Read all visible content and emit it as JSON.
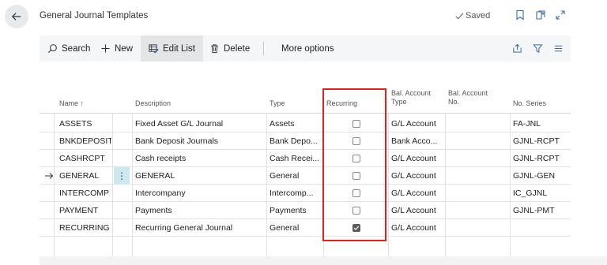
{
  "header": {
    "title": "General Journal Templates",
    "saved_label": "Saved"
  },
  "actions": {
    "search": "Search",
    "new": "New",
    "edit_list": "Edit List",
    "delete": "Delete",
    "more": "More options"
  },
  "columns": {
    "name": "Name ↑",
    "description": "Description",
    "type": "Type",
    "recurring": "Recurring",
    "bal_type_1": "Bal. Account",
    "bal_type_2": "Type",
    "bal_no_1": "Bal. Account",
    "bal_no_2": "No.",
    "no_series": "No. Series"
  },
  "rows": [
    {
      "name": "ASSETS",
      "description": "Fixed Asset G/L Journal",
      "type": "Assets",
      "recurring": false,
      "bal_type": "G/L Account",
      "bal_no": "",
      "no_series": "FA-JNL"
    },
    {
      "name": "BNKDEPOSIT",
      "description": "Bank Deposit Journals",
      "type": "Bank Depo...",
      "recurring": false,
      "bal_type": "Bank Acco...",
      "bal_no": "",
      "no_series": "GJNL-RCPT"
    },
    {
      "name": "CASHRCPT",
      "description": "Cash receipts",
      "type": "Cash Recei...",
      "recurring": false,
      "bal_type": "G/L Account",
      "bal_no": "",
      "no_series": "GJNL-RCPT"
    },
    {
      "name": "GENERAL",
      "description": "GENERAL",
      "type": "General",
      "recurring": false,
      "bal_type": "G/L Account",
      "bal_no": "",
      "no_series": "GJNL-GEN"
    },
    {
      "name": "INTERCOMP",
      "description": "Intercompany",
      "type": "Intercomp...",
      "recurring": false,
      "bal_type": "G/L Account",
      "bal_no": "",
      "no_series": "IC_GJNL"
    },
    {
      "name": "PAYMENT",
      "description": "Payments",
      "type": "Payments",
      "recurring": false,
      "bal_type": "G/L Account",
      "bal_no": "",
      "no_series": "GJNL-PMT"
    },
    {
      "name": "RECURRING",
      "description": "Recurring General Journal",
      "type": "General",
      "recurring": true,
      "bal_type": "G/L Account",
      "bal_no": "",
      "no_series": ""
    }
  ],
  "colors": {
    "highlight": "#e51f1f",
    "selected_row_menu": "#cbe9ee"
  }
}
